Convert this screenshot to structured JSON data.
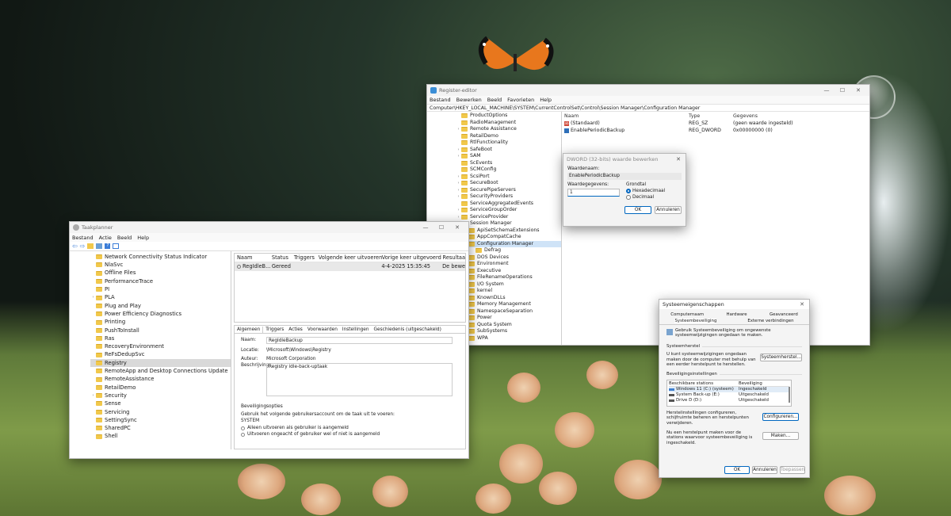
{
  "registry": {
    "title": "Register-editor",
    "menu": [
      "Bestand",
      "Bewerken",
      "Beeld",
      "Favorieten",
      "Help"
    ],
    "address": "Computer\\HKEY_LOCAL_MACHINE\\SYSTEM\\CurrentControlSet\\Control\\Session Manager\\Configuration Manager",
    "tree": [
      "ProductOptions",
      "RadioManagement",
      "Remote Assistance",
      "RetailDemo",
      "RtlFunctionality",
      "SafeBoot",
      "SAM",
      "ScEvents",
      "SCMConfig",
      "ScsiPort",
      "SecureBoot",
      "SecurePipeServers",
      "SecurityProviders",
      "ServiceAggregatedEvents",
      "ServiceGroupOrder",
      "ServiceProvider",
      "Session Manager",
      "ApiSetSchemaExtensions",
      "AppCompatCache",
      "Configuration Manager",
      "Defrag",
      "DOS Devices",
      "Environment",
      "Executive",
      "FileRenameOperations",
      "I/O System",
      "kernel",
      "KnownDLLs",
      "Memory Management",
      "NamespaceSeparation",
      "Power",
      "Quota System",
      "SubSystems",
      "WPA"
    ],
    "columns": [
      "Naam",
      "Type",
      "Gegevens"
    ],
    "rows": [
      {
        "name": "(Standaard)",
        "type": "REG_SZ",
        "data": "(geen waarde ingesteld)"
      },
      {
        "name": "EnablePeriodicBackup",
        "type": "REG_DWORD",
        "data": "0x00000000 (0)"
      }
    ]
  },
  "dword": {
    "title": "DWORD (32-bits) waarde bewerken",
    "name_label": "Waardenaam:",
    "name_value": "EnablePeriodicBackup",
    "data_label": "Waardegegevens:",
    "data_value": "1",
    "base_label": "Grondtal",
    "hex": "Hexadecimaal",
    "dec": "Decimaal",
    "ok": "OK",
    "cancel": "Annuleren"
  },
  "task": {
    "title": "Taakplanner",
    "menu": [
      "Bestand",
      "Actie",
      "Beeld",
      "Help"
    ],
    "tree": [
      "Network Connectivity Status Indicator",
      "NlaSvc",
      "Offline Files",
      "PerformanceTrace",
      "PI",
      "PLA",
      "Plug and Play",
      "Power Efficiency Diagnostics",
      "Printing",
      "PushToInstall",
      "Ras",
      "RecoveryEnvironment",
      "ReFsDedupSvc",
      "Registry",
      "RemoteApp and Desktop Connections Update",
      "RemoteAssistance",
      "RetailDemo",
      "Security",
      "Sense",
      "Servicing",
      "SettingSync",
      "SharedPC",
      "Shell"
    ],
    "columns": [
      "Naam",
      "Status",
      "Triggers",
      "Volgende keer uitvoeren",
      "Vorige keer uitgevoerd",
      "Resultaa"
    ],
    "row": {
      "name": "RegIdleB...",
      "status": "Gereed",
      "triggers": "",
      "next": "",
      "last": "4-4-2025 15:35:45",
      "result": "De bewe"
    },
    "tabs": [
      "Algemeen",
      "Triggers",
      "Acties",
      "Voorwaarden",
      "Instellingen",
      "Geschiedenis (uitgeschakeld)"
    ],
    "fields": {
      "name_label": "Naam:",
      "name_value": "RegIdleBackup",
      "loc_label": "Locatie:",
      "loc_value": "\\Microsoft\\Windows\\Registry",
      "auth_label": "Auteur:",
      "auth_value": "Microsoft Corporation",
      "desc_label": "Beschrijving:",
      "desc_value": "Registry idle-back-uptaak"
    },
    "security": {
      "heading": "Beveiligingsopties",
      "text": "Gebruik het volgende gebruikersaccount om de taak uit te voeren:",
      "account": "SYSTEM",
      "opt1": "Alleen uitvoeren als gebruiker is aangemeld",
      "opt2": "Uitvoeren ongeacht of gebruiker wel of niet is aangemeld"
    }
  },
  "sysprops": {
    "title": "Systeemeigenschappen",
    "tabs_row1": [
      "Computernaam",
      "Hardware",
      "Geavanceerd"
    ],
    "tabs_row2": [
      "Systeembeveiliging",
      "Externe verbindingen"
    ],
    "intro": "Gebruik Systeembeveiliging om ongewenste systeemwijzigingen ongedaan te maken.",
    "restore_heading": "Systeemherstel",
    "restore_text": "U kunt systeemwijzigingen ongedaan maken door de computer met behulp van een eerder herstelpunt te herstellen.",
    "restore_btn": "Systeemherstel...",
    "settings_heading": "Beveiligingsinstellingen",
    "col1": "Beschikbare stations",
    "col2": "Beveiliging",
    "drives": [
      {
        "name": "Windows 11 (C:) (systeem)",
        "status": "Ingeschakeld"
      },
      {
        "name": "System Back-up (E:)",
        "status": "Uitgeschakeld"
      },
      {
        "name": "Drive D (D:)",
        "status": "Uitgeschakeld"
      }
    ],
    "config_text": "Herstelinstellingen configureren, schijfruimte beheren en herstelpunten verwijderen.",
    "config_btn": "Configureren...",
    "create_text": "Nu een herstelpunt maken voor de stations waarvoor systeembeveiliging is ingeschakeld.",
    "create_btn": "Maken...",
    "ok": "OK",
    "cancel": "Annuleren",
    "apply": "Toepassen"
  },
  "colors": {
    "accent": "#0067c0",
    "folder": "#f1c84b",
    "selection": "#cfe3f7"
  }
}
